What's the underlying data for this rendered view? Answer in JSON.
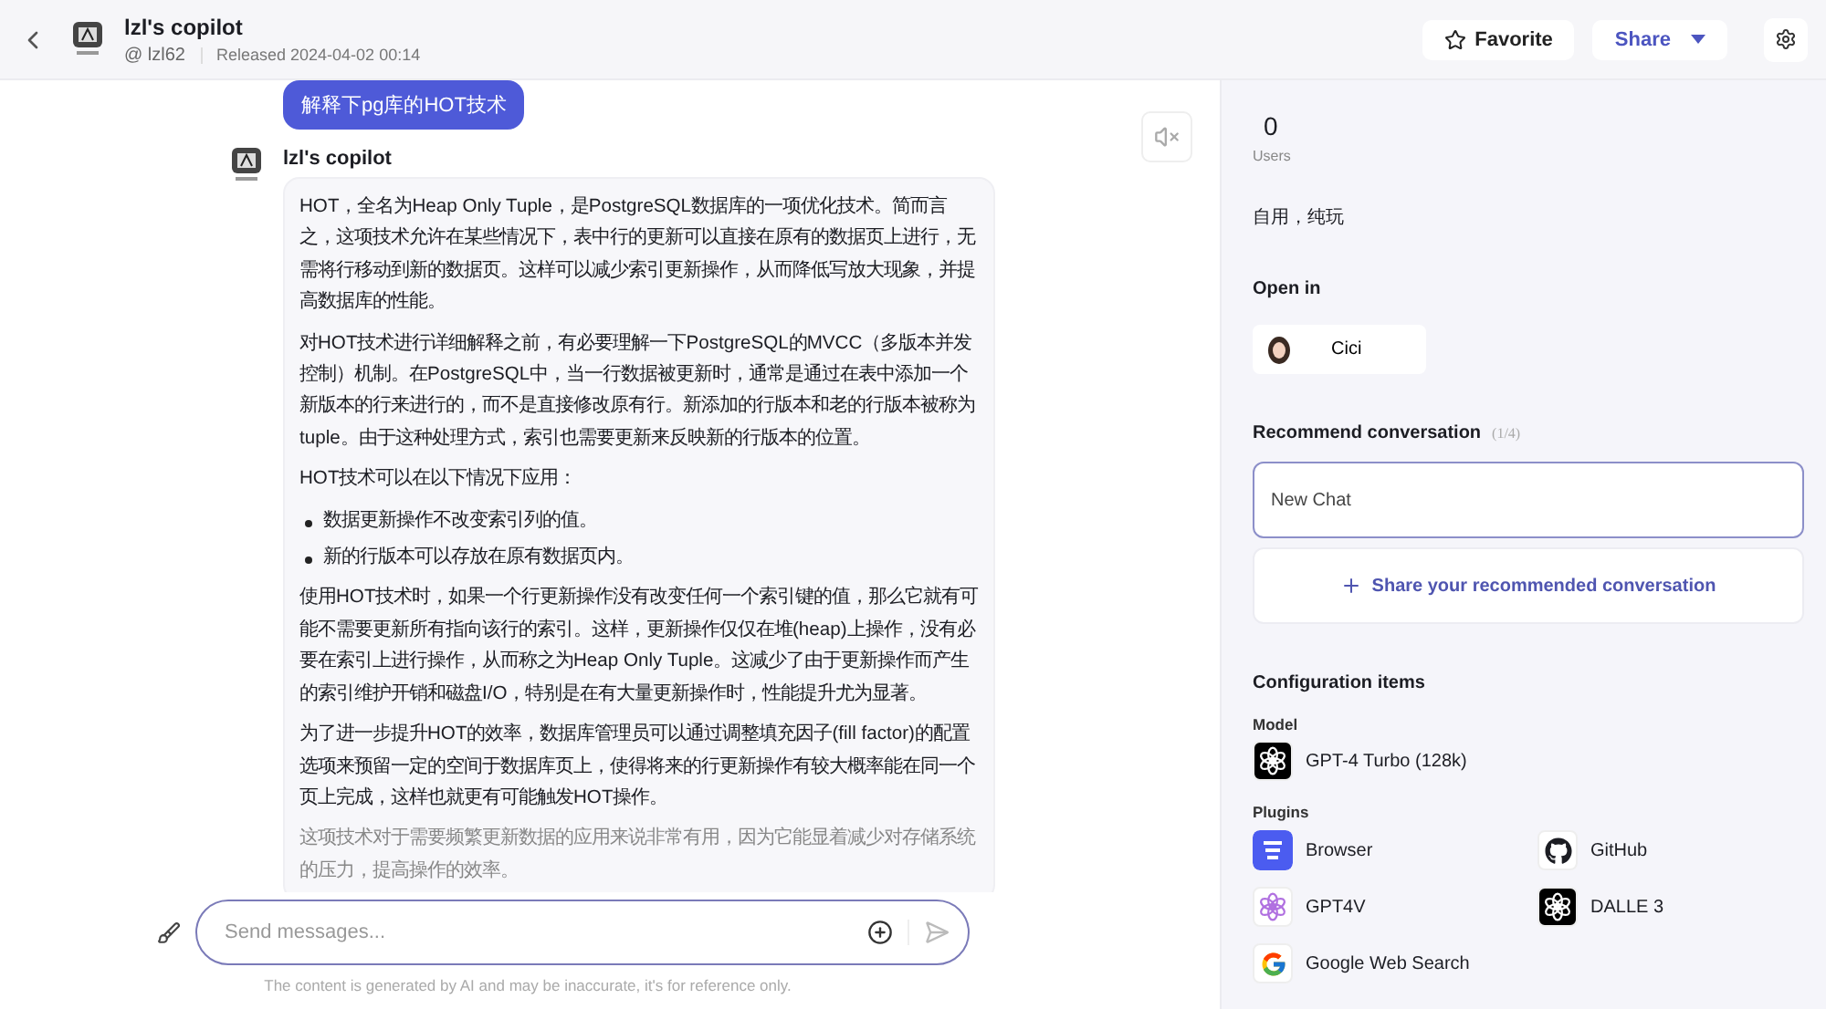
{
  "header": {
    "title": "lzl's copilot",
    "author": "@ lzl62",
    "released": "Released 2024-04-02 00:14",
    "buttons": [
      {
        "kind": "favorite",
        "label": "Favorite"
      },
      {
        "kind": "share",
        "label": "Share"
      }
    ]
  },
  "chat": {
    "user_message": "解释下pg库的HOT技术",
    "bot_name": "lzl's copilot",
    "blocks": [
      {
        "kind": "paragraph",
        "text": "HOT，全名为Heap Only Tuple，是PostgreSQL数据库的一项优化技术。简而言之，这项技术允许在某些情况下，表中行的更新可以直接在原有的数据页上进行，无需将行移动到新的数据页。这样可以减少索引更新操作，从而降低写放大现象，并提高数据库的性能。"
      },
      {
        "kind": "paragraph",
        "text": "对HOT技术进行详细解释之前，有必要理解一下PostgreSQL的MVCC（多版本并发控制）机制。在PostgreSQL中，当一行数据被更新时，通常是通过在表中添加一个新版本的行来进行的，而不是直接修改原有行。新添加的行版本和老的行版本被称为tuple。由于这种处理方式，索引也需要更新来反映新的行版本的位置。"
      },
      {
        "kind": "paragraph",
        "text": "HOT技术可以在以下情况下应用："
      },
      {
        "kind": "list",
        "items": [
          "数据更新操作不改变索引列的值。",
          "新的行版本可以存放在原有数据页内。"
        ]
      },
      {
        "kind": "paragraph",
        "text": "使用HOT技术时，如果一个行更新操作没有改变任何一个索引键的值，那么它就有可能不需要更新所有指向该行的索引。这样，更新操作仅仅在堆(heap)上操作，没有必要在索引上进行操作，从而称之为Heap Only Tuple。这减少了由于更新操作而产生的索引维护开销和磁盘I/O，特别是在有大量更新操作时，性能提升尤为显著。"
      },
      {
        "kind": "paragraph",
        "text": "为了进一步提升HOT的效率，数据库管理员可以通过调整填充因子(fill factor)的配置选项来预留一定的空间于数据库页上，使得将来的行更新操作有较大概率能在同一个页上完成，这样也就更有可能触发HOT操作。"
      },
      {
        "kind": "paragraph",
        "text": "这项技术对于需要频繁更新数据的应用来说非常有用，因为它能显着减少对存储系统的压力，提高操作的效率。"
      }
    ],
    "input": {
      "placeholder": "Send messages..."
    },
    "disclaimer": "The content is generated by AI and may be inaccurate, it's for reference only."
  },
  "panel": {
    "users_count": "0",
    "users_label": "Users",
    "description": "自用，纯玩",
    "open_in_title": "Open in",
    "open_in_app": "Cici",
    "recommend_title": "Recommend conversation",
    "recommend_count": "(1/4)",
    "conversations": [
      {
        "title": "New Chat",
        "selected": true
      }
    ],
    "share_conversation": "Share your recommended conversation",
    "config_title": "Configuration items",
    "model_label": "Model",
    "model": "GPT-4 Turbo (128k)",
    "plugins_label": "Plugins",
    "plugins": [
      {
        "kind": "browser",
        "name": "Browser"
      },
      {
        "kind": "github",
        "name": "GitHub"
      },
      {
        "kind": "gpt4v",
        "name": "GPT4V"
      },
      {
        "kind": "dalle",
        "name": "DALLE 3"
      },
      {
        "kind": "google",
        "name": "Google Web Search"
      }
    ]
  }
}
